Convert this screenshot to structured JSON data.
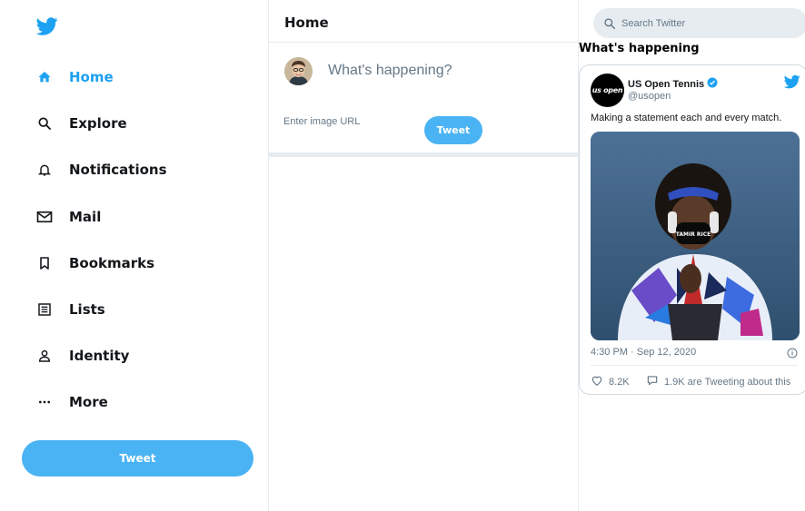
{
  "sidebar": {
    "logo": "twitter-bird-icon",
    "items": [
      {
        "label": "Home",
        "icon": "home-icon"
      },
      {
        "label": "Explore",
        "icon": "search-icon"
      },
      {
        "label": "Notifications",
        "icon": "bell-icon"
      },
      {
        "label": "Mail",
        "icon": "mail-icon"
      },
      {
        "label": "Bookmarks",
        "icon": "bookmark-icon"
      },
      {
        "label": "Lists",
        "icon": "list-icon"
      },
      {
        "label": "Identity",
        "icon": "person-icon"
      },
      {
        "label": "More",
        "icon": "more-icon"
      }
    ],
    "tweet_label": "Tweet"
  },
  "main": {
    "title": "Home",
    "composer": {
      "placeholder": "What's happening?",
      "url_placeholder": "Enter image URL",
      "tweet_label": "Tweet"
    }
  },
  "right": {
    "search_placeholder": "Search Twitter",
    "section_title": "What's happening",
    "embed": {
      "avatar_text": "us open",
      "name": "US Open Tennis",
      "handle": "@usopen",
      "text": "Making a statement each and every match.",
      "timestamp": "4:30 PM · Sep 12, 2020",
      "likes": "8.2K",
      "conversation": "1.9K are Tweeting about this"
    }
  },
  "colors": {
    "accent": "#1da1f2",
    "button": "#4ab3f4",
    "border": "#e6ecf0",
    "muted": "#657786"
  }
}
